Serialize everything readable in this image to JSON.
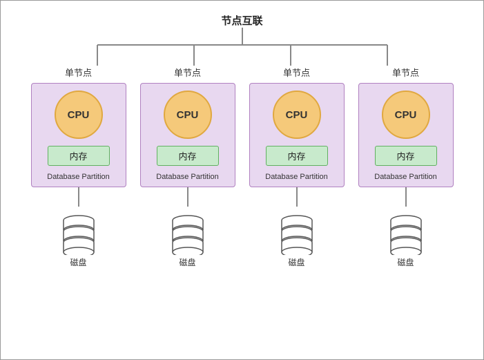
{
  "title": "节点互联",
  "nodes": [
    {
      "label": "单节点",
      "cpu": "CPU",
      "mem": "内存",
      "partition": "Database Partition",
      "disk_label": "磁盘"
    },
    {
      "label": "单节点",
      "cpu": "CPU",
      "mem": "内存",
      "partition": "Database Partition",
      "disk_label": "磁盘"
    },
    {
      "label": "单节点",
      "cpu": "CPU",
      "mem": "内存",
      "partition": "Database Partition",
      "disk_label": "磁盘"
    },
    {
      "label": "单节点",
      "cpu": "CPU",
      "mem": "内存",
      "partition": "Database Partition",
      "disk_label": "磁盘"
    }
  ]
}
